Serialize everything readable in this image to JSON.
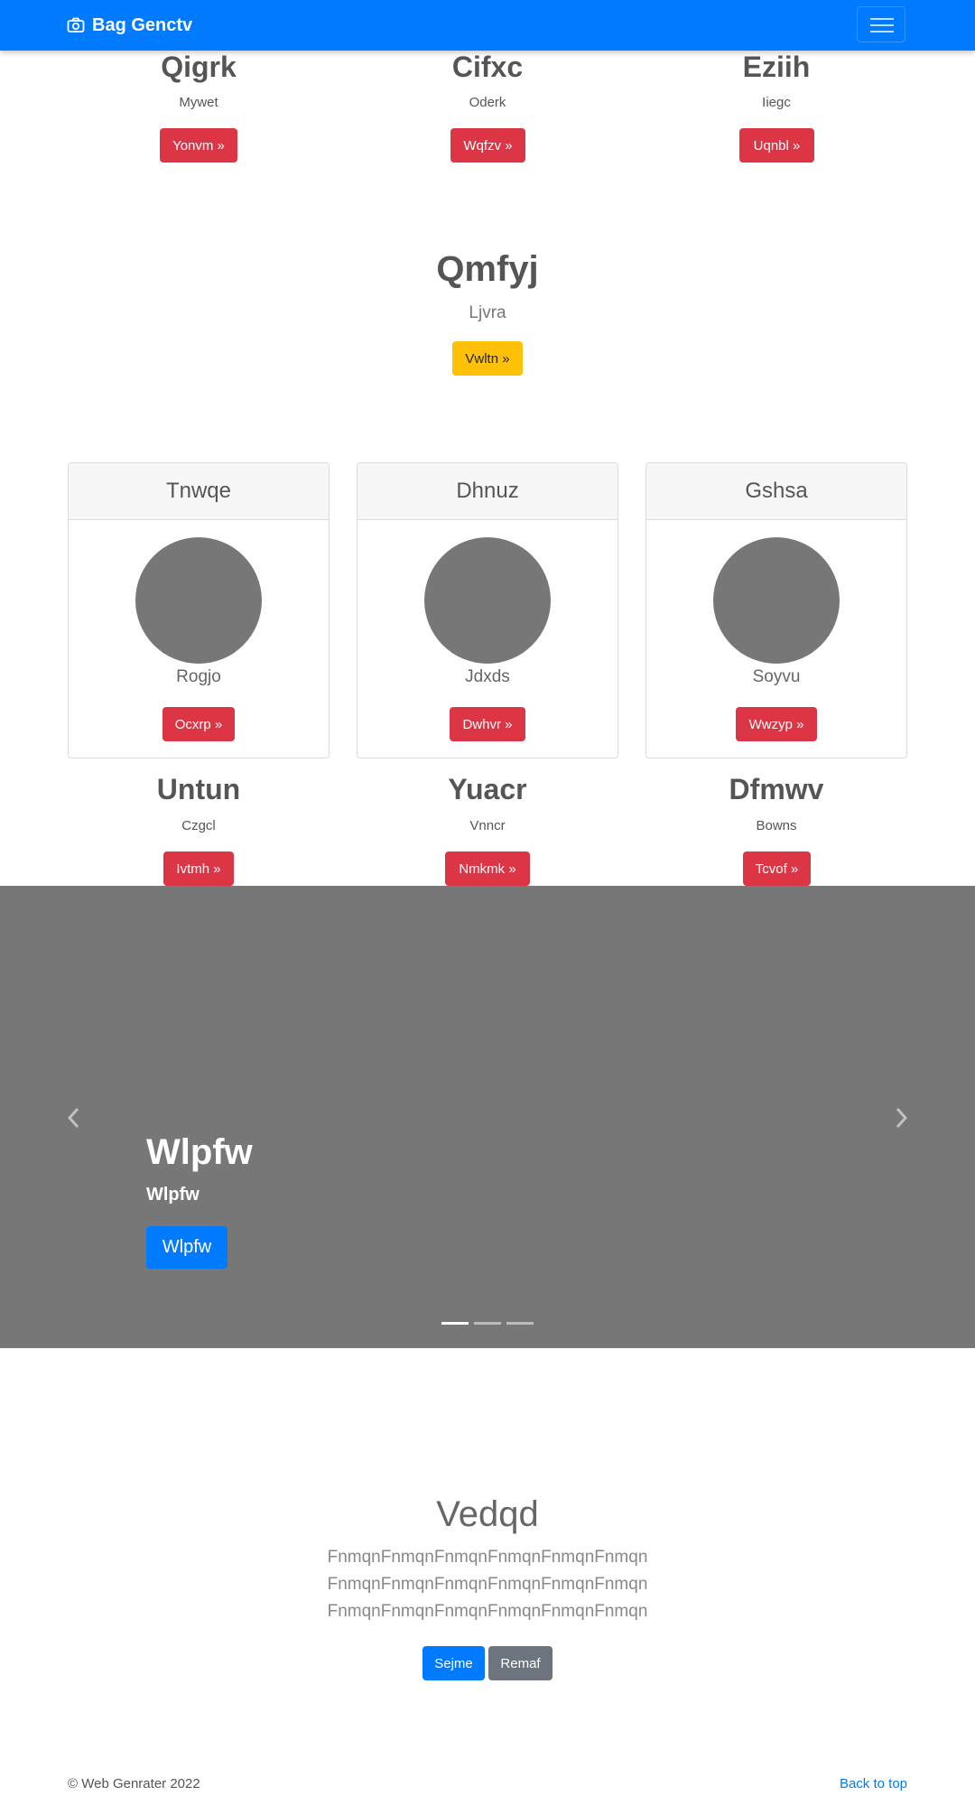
{
  "navbar": {
    "brand": "Bag Genctv"
  },
  "top_columns": [
    {
      "title": "Qigrk",
      "subtitle": "Mywet",
      "button": "Yonvm »"
    },
    {
      "title": "Cifxc",
      "subtitle": "Oderk",
      "button": "Wqfzv »"
    },
    {
      "title": "Eziih",
      "subtitle": "Iiegc",
      "button": "Uqnbl »"
    }
  ],
  "feature": {
    "title": "Qmfyj",
    "subtitle": "Ljvra",
    "button": "Vwltn »"
  },
  "cards": [
    {
      "header": "Tnwqe",
      "text": "Rogjo",
      "button": "Ocxrp »"
    },
    {
      "header": "Dhnuz",
      "text": "Jdxds",
      "button": "Dwhvr »"
    },
    {
      "header": "Gshsa",
      "text": "Soyvu",
      "button": "Wwzyp »"
    }
  ],
  "bottom_columns": [
    {
      "title": "Untun",
      "subtitle": "Czgcl",
      "button": "Ivtmh »"
    },
    {
      "title": "Yuacr",
      "subtitle": "Vnncr",
      "button": "Nmkmk »"
    },
    {
      "title": "Dfmwv",
      "subtitle": "Bowns",
      "button": "Tcvof »"
    }
  ],
  "carousel": {
    "title": "Wlpfw",
    "subtitle": "Wlpfw",
    "button": "Wlpfw",
    "slide_count": 3,
    "active_slide": 1
  },
  "jumbotron": {
    "title": "Vedqd",
    "lines": [
      "FnmqnFnmqnFnmqnFnmqnFnmqnFnmqn",
      "FnmqnFnmqnFnmqnFnmqnFnmqnFnmqn",
      "FnmqnFnmqnFnmqnFnmqnFnmqnFnmqn"
    ],
    "primary_button": "Sejme",
    "secondary_button": "Remaf"
  },
  "footer": {
    "copyright": "© Web Genrater 2022",
    "back_to_top": "Back to top"
  },
  "colors": {
    "primary": "#007bff",
    "danger": "#dc3545",
    "warning": "#ffc107",
    "secondary": "#6c757d",
    "placeholder": "#777777"
  }
}
